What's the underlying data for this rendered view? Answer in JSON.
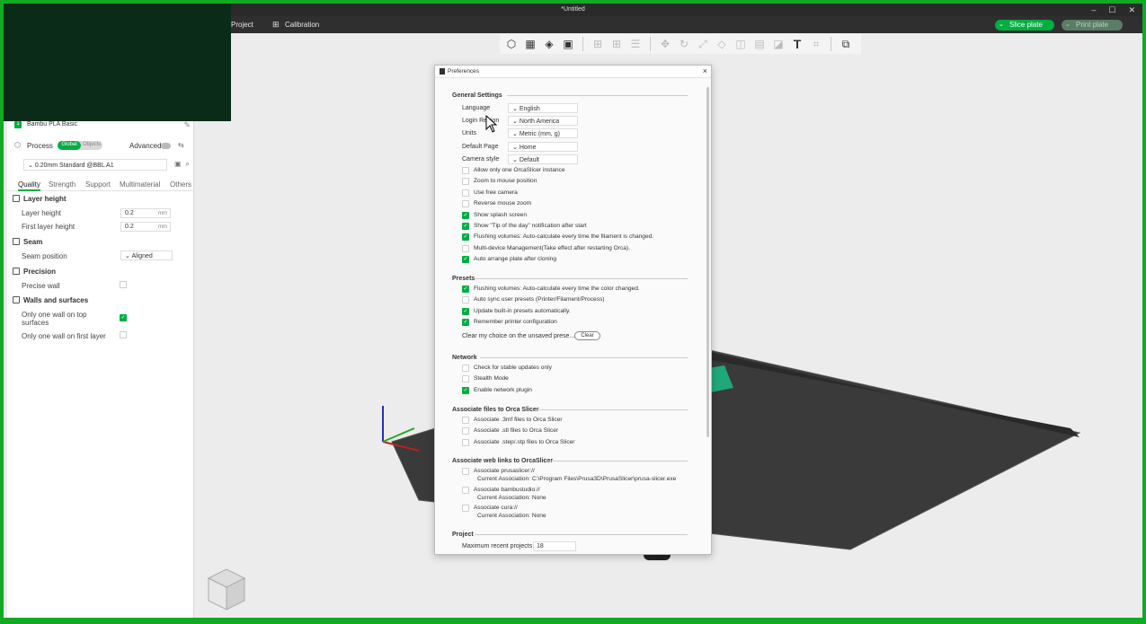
{
  "window": {
    "title": "*Untitled"
  },
  "menu": {
    "project": "Project",
    "calibration": "Calibration",
    "slice_plate": "Slice plate",
    "print_plate": "Print plate"
  },
  "sidebar": {
    "filament_slot": "1",
    "filament_name": "Bambu PLA Basic",
    "process_label": "Process",
    "toggle_global": "Global",
    "toggle_objects": "Objects",
    "advanced_label": "Advanced",
    "preset": "0.20mm Standard @BBL A1",
    "tabs": [
      "Quality",
      "Strength",
      "Support",
      "Multimaterial",
      "Others"
    ],
    "sections": {
      "layer_height": "Layer height",
      "seam": "Seam",
      "precision": "Precision",
      "walls": "Walls and surfaces"
    },
    "fields": {
      "layer_height": {
        "label": "Layer height",
        "value": "0.2",
        "unit": "mm"
      },
      "first_layer_height": {
        "label": "First layer height",
        "value": "0.2",
        "unit": "mm"
      },
      "seam_position": {
        "label": "Seam position",
        "value": "Aligned"
      },
      "precise_wall": {
        "label": "Precise wall"
      },
      "one_wall_top": {
        "label_line1": "Only one wall on top",
        "label_line2": "surfaces"
      },
      "one_wall_first": {
        "label": "Only one wall on first layer"
      }
    }
  },
  "dialog": {
    "title": "Preferences",
    "general": {
      "heading": "General Settings",
      "language_label": "Language",
      "language_value": "English",
      "login_region_label": "Login Region",
      "login_region_value": "North America",
      "units_label": "Units",
      "units_value": "Metric (mm, g)",
      "default_page_label": "Default Page",
      "default_page_value": "Home",
      "camera_style_label": "Camera style",
      "camera_style_value": "Default"
    },
    "general_options": [
      {
        "label": "Allow only one OrcaSlicer instance",
        "checked": false
      },
      {
        "label": "Zoom to mouse position",
        "checked": false
      },
      {
        "label": "Use free camera",
        "checked": false
      },
      {
        "label": "Reverse mouse zoom",
        "checked": false
      },
      {
        "label": "Show splash screen",
        "checked": true
      },
      {
        "label": "Show \"Tip of the day\" notification after start",
        "checked": true
      },
      {
        "label": "Flushing volumes: Auto-calculate every time the filament is changed.",
        "checked": true
      },
      {
        "label": "Multi-device Management(Take effect after restarting Orca).",
        "checked": false
      },
      {
        "label": "Auto arrange plate after cloning",
        "checked": true
      }
    ],
    "presets": {
      "heading": "Presets",
      "options": [
        {
          "label": "Flushing volumes: Auto-calculate every time the color changed.",
          "checked": true
        },
        {
          "label": "Auto sync user presets (Printer/Filament/Process)",
          "checked": false
        },
        {
          "label": "Update built-in presets automatically.",
          "checked": true
        },
        {
          "label": "Remember printer configuration",
          "checked": true
        }
      ],
      "clear_text": "Clear my choice on the unsaved prese...",
      "clear_button": "Clear"
    },
    "network": {
      "heading": "Network",
      "options": [
        {
          "label": "Check for stable updates only",
          "checked": false
        },
        {
          "label": "Stealth Mode",
          "checked": false
        },
        {
          "label": "Enable network plugin",
          "checked": true
        }
      ]
    },
    "assoc_files": {
      "heading": "Associate files to Orca Slicer",
      "options": [
        {
          "label": "Associate .3mf files to Orca Slicer",
          "checked": false
        },
        {
          "label": "Associate .stl files to Orca Slicer",
          "checked": false
        },
        {
          "label": "Associate .step/.stp files to Orca Slicer",
          "checked": false
        }
      ]
    },
    "assoc_links": {
      "heading": "Associate web links to OrcaSlicer",
      "items": [
        {
          "label": "Associate prusaslicer://",
          "current": "Current Association:  C:\\Program Files\\Prusa3D\\PrusaSlicer\\prusa-slicer.exe"
        },
        {
          "label": "Associate bambustudio://",
          "current": "Current Association:  None"
        },
        {
          "label": "Associate cura://",
          "current": "Current Association:  None"
        }
      ]
    },
    "project": {
      "heading": "Project",
      "max_recent_label": "Maximum recent projects",
      "max_recent_value": "18"
    }
  },
  "colors": {
    "accent": "#00ae42",
    "frame": "#11aa22",
    "dark_panel": "#0a2b17",
    "menubar": "#2f2f2f"
  }
}
